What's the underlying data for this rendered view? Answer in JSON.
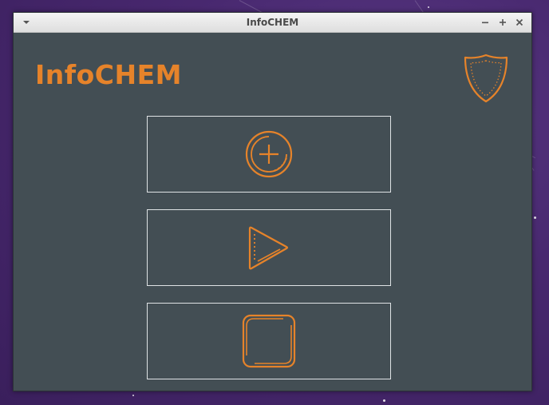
{
  "window": {
    "title": "InfoCHEM"
  },
  "app": {
    "title": "InfoCHEM",
    "accent_color": "#e6832a",
    "background_color": "#434e54",
    "border_color": "#dfe3e5"
  },
  "icons": {
    "window_menu": "chevron-down-icon",
    "minimize": "minimize-icon",
    "maximize": "maximize-icon",
    "close": "close-icon",
    "badge": "shield-icon"
  },
  "buttons": [
    {
      "icon": "add-circle-icon"
    },
    {
      "icon": "play-icon"
    },
    {
      "icon": "stop-icon"
    }
  ]
}
